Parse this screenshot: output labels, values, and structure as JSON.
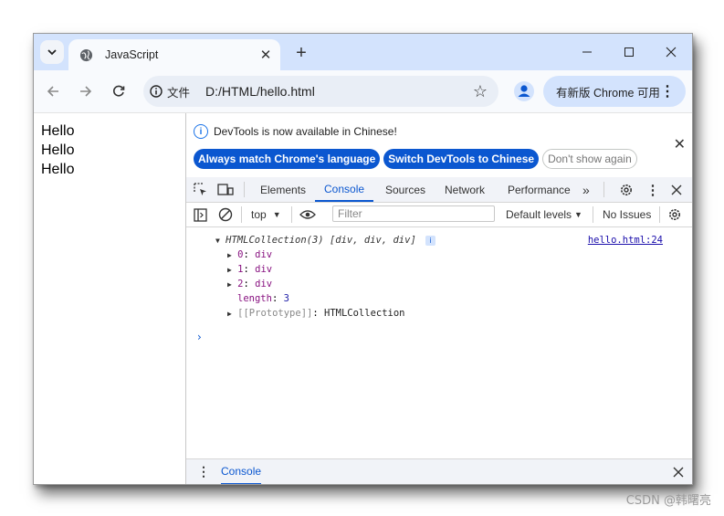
{
  "tab": {
    "title": "JavaScript",
    "new_tab": "+"
  },
  "window_controls": {
    "minimize": "—",
    "maximize": "☐",
    "close": "✕"
  },
  "omnibox": {
    "chip": "文件",
    "url": "D:/HTML/hello.html"
  },
  "promo": {
    "label": "有新版 Chrome 可用"
  },
  "page": {
    "lines": [
      "Hello",
      "Hello",
      "Hello"
    ]
  },
  "devtools": {
    "info_message": "DevTools is now available in Chinese!",
    "btn_match": "Always match Chrome's language",
    "btn_switch": "Switch DevTools to Chinese",
    "btn_dont_show": "Don't show again",
    "tabs": [
      "Elements",
      "Console",
      "Sources",
      "Network",
      "Performance"
    ],
    "more_tabs": "»",
    "context": "top",
    "filter_placeholder": "Filter",
    "levels": "Default levels",
    "issues": "No Issues",
    "console": {
      "header": "HTMLCollection(3) [div, div, div]",
      "source": "hello.html:24",
      "items": [
        {
          "key": "0",
          "value": "div"
        },
        {
          "key": "1",
          "value": "div"
        },
        {
          "key": "2",
          "value": "div"
        }
      ],
      "length_key": "length",
      "length_val": "3",
      "proto_key": "[[Prototype]]",
      "proto_val": "HTMLCollection",
      "prompt": "›"
    },
    "drawer_tab": "Console"
  },
  "watermark": "CSDN @韩曙亮"
}
